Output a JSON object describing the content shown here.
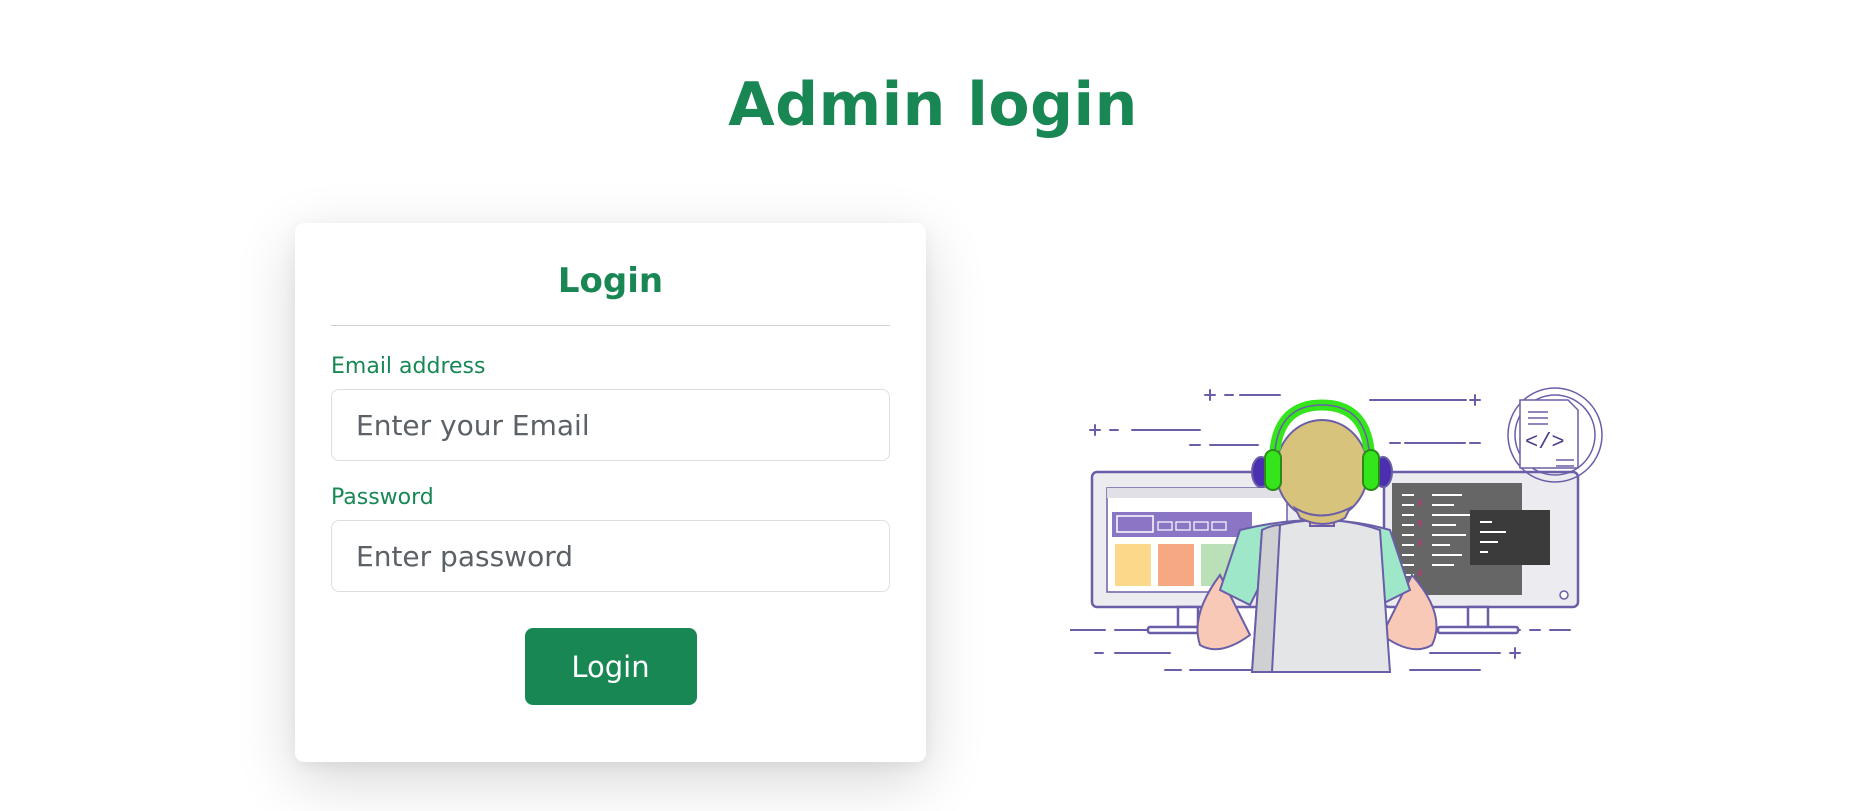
{
  "page": {
    "title": "Admin login"
  },
  "card": {
    "title": "Login",
    "email": {
      "label": "Email address",
      "placeholder": "Enter your Email"
    },
    "password": {
      "label": "Password",
      "placeholder": "Enter password"
    },
    "submit_label": "Login"
  },
  "illustration": {
    "icon": "developer-at-monitors-illustration"
  },
  "colors": {
    "accent": "#198754",
    "headphones": "#33e51a",
    "outline": "#6b5ea8"
  }
}
